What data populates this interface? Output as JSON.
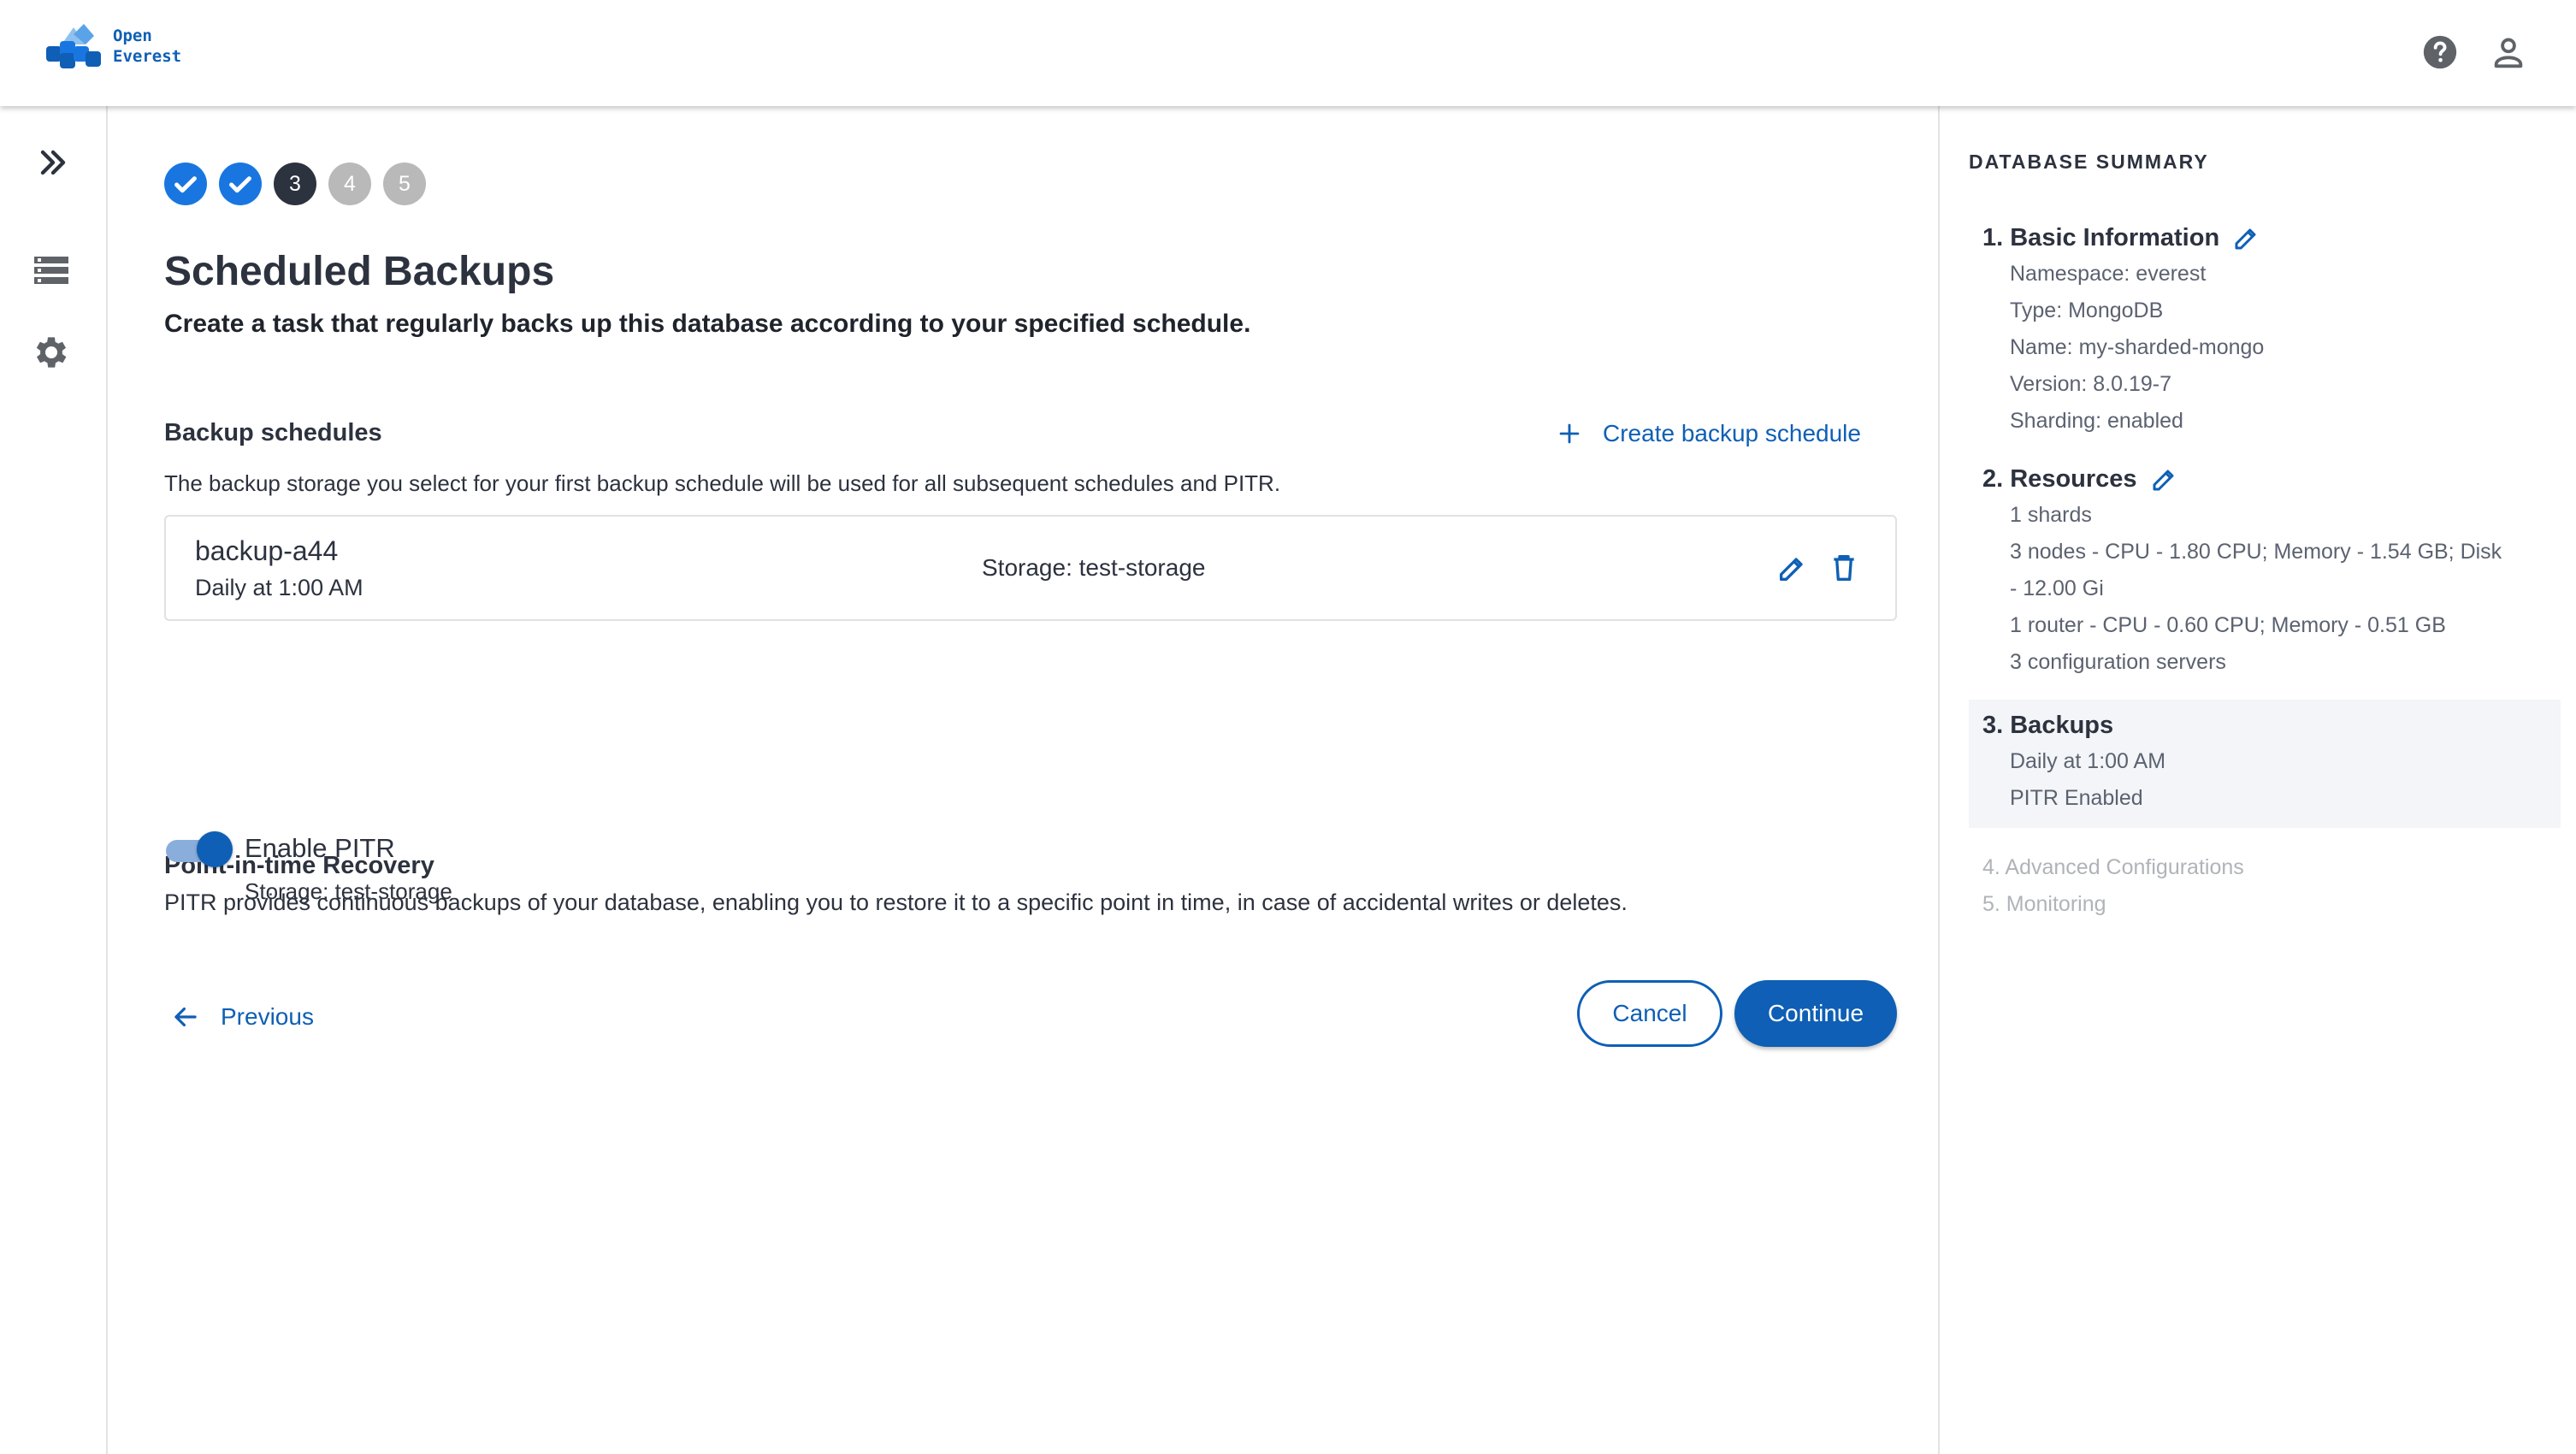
{
  "app": {
    "logo_line1": "Open",
    "logo_line2": "Everest",
    "icons": {
      "help": "help-circle-icon",
      "account": "account-icon"
    }
  },
  "nav": {
    "icons": [
      "double-chevron-right-icon",
      "databases-list-icon",
      "settings-gear-icon"
    ]
  },
  "stepper": {
    "steps": [
      {
        "label": "1",
        "state": "done"
      },
      {
        "label": "2",
        "state": "done"
      },
      {
        "label": "3",
        "state": "active"
      },
      {
        "label": "4",
        "state": "todo"
      },
      {
        "label": "5",
        "state": "todo"
      }
    ]
  },
  "page": {
    "title": "Scheduled Backups",
    "subtitle": "Create a task that regularly backs up this database according to your specified schedule."
  },
  "backups": {
    "title": "Backup schedules",
    "create_label": "Create backup schedule",
    "description": "The backup storage you select for your first backup schedule will be used for all subsequent schedules and PITR.",
    "schedules": [
      {
        "name": "backup-a44",
        "time": "Daily at 1:00 AM",
        "storage": "Storage: test-storage"
      }
    ]
  },
  "pitr": {
    "title": "Point-in-time Recovery",
    "description": "PITR provides continuous backups of your database, enabling you to restore it to a specific point in time, in case of accidental writes or deletes.",
    "toggle_label": "Enable PITR",
    "enabled": true,
    "storage": "Storage: test-storage"
  },
  "actions": {
    "previous": "Previous",
    "cancel": "Cancel",
    "continue": "Continue"
  },
  "summary": {
    "heading": "DATABASE SUMMARY",
    "basic": {
      "title": "1. Basic Information",
      "lines": [
        "Namespace: everest",
        "Type: MongoDB",
        "Name: my-sharded-mongo",
        "Version: 8.0.19-7",
        "Sharding: enabled"
      ]
    },
    "resources": {
      "title": "2. Resources",
      "lines": [
        "1 shards",
        "3 nodes - CPU - 1.80 CPU; Memory - 1.54 GB; Disk",
        "- 12.00 Gi",
        "1 router - CPU - 0.60 CPU; Memory - 0.51 GB",
        "3 configuration servers"
      ]
    },
    "backups": {
      "title": "3. Backups",
      "lines": [
        "Daily at 1:00 AM",
        "PITR Enabled"
      ]
    },
    "advanced": "4. Advanced Configurations",
    "monitoring": "5. Monitoring"
  },
  "colors": {
    "primary": "#0e5fb5",
    "step_done": "#1976e0",
    "step_active": "#2c323e",
    "step_todo": "#b9b9b9",
    "text": "#2c323e",
    "muted": "#5b6270",
    "disabled": "#b0b3b8"
  }
}
